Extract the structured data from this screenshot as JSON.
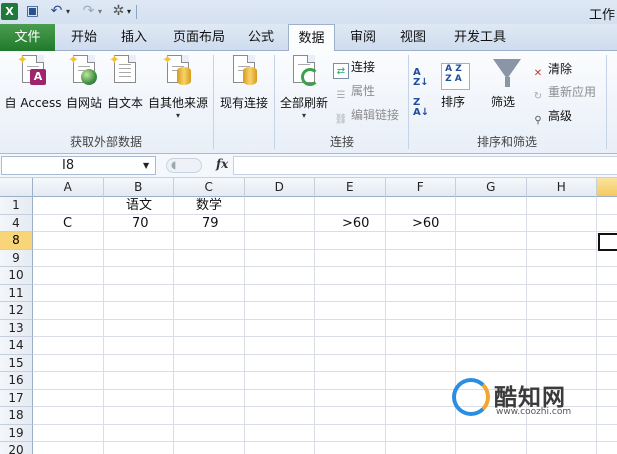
{
  "window": {
    "title": "工作"
  },
  "tabs": [
    "文件",
    "开始",
    "插入",
    "页面布局",
    "公式",
    "数据",
    "审阅",
    "视图",
    "开发工具"
  ],
  "active_tab": "数据",
  "ribbon": {
    "external_data": {
      "group_label": "获取外部数据",
      "from_access": "自 Access",
      "from_web": "自网站",
      "from_text": "自文本",
      "from_other": "自其他来源"
    },
    "existing_connections": "现有连接",
    "connections": {
      "group_label": "连接",
      "refresh_all": "全部刷新",
      "connections": "连接",
      "properties": "属性",
      "edit_links": "编辑链接"
    },
    "sort_filter": {
      "group_label": "排序和筛选",
      "sort": "排序",
      "filter": "筛选",
      "clear": "清除",
      "reapply": "重新应用",
      "advanced": "高级"
    }
  },
  "formula_bar": {
    "name_box": "I8",
    "fx": "fx",
    "formula": ""
  },
  "sheet": {
    "columns": [
      "A",
      "B",
      "C",
      "D",
      "E",
      "F",
      "G",
      "H"
    ],
    "rows": [
      "1",
      "4",
      "8",
      "9",
      "10",
      "11",
      "12",
      "13",
      "14",
      "15",
      "16",
      "17",
      "18",
      "19",
      "20"
    ],
    "selected_row": "8",
    "cells": {
      "B1": "语文",
      "C1": "数学",
      "A4": "C",
      "B4": "70",
      "C4": "79",
      "E4": ">60",
      "F4": ">60"
    }
  },
  "watermark": {
    "name": "酷知网",
    "url": "www.coozhi.com"
  }
}
